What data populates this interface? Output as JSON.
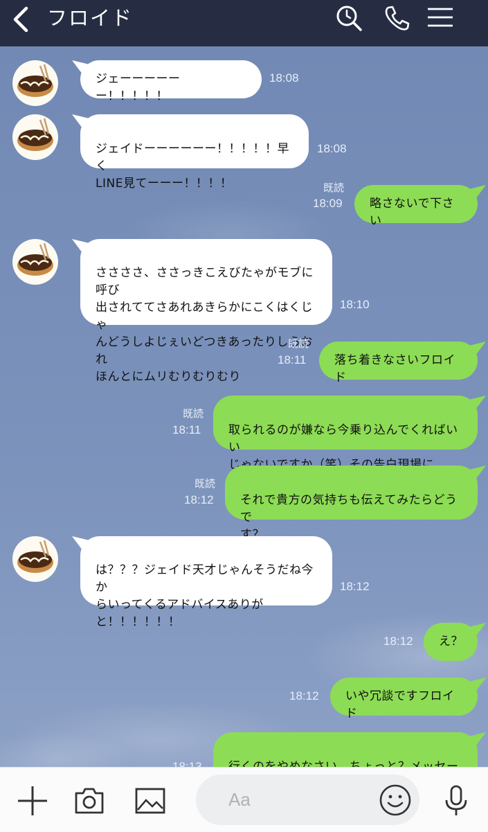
{
  "header": {
    "title": "フロイド"
  },
  "colors": {
    "header_bg": "#262d43",
    "chat_bg": "#7a90b8",
    "incoming_bubble": "#ffffff",
    "outgoing_bubble": "#8ddc55"
  },
  "messages": [
    {
      "side": "in",
      "text": "ジェーーーーーー！！！！！",
      "time": "18:08"
    },
    {
      "side": "in",
      "text": "ジェイドーーーーーー！！！！！早く\nLINE見てーーー！！！！",
      "time": "18:08"
    },
    {
      "side": "out",
      "text": "略さないで下さい",
      "time": "18:09",
      "read": "既読"
    },
    {
      "side": "in",
      "text": "ささささ、ささっきこえびたゃがモブに呼び\n出されててさあれあきらかにこくはくじゃ\nんどうしよじぇいどつきあったりしらおれ\nほんとにムリむりむりむり",
      "time": "18:10"
    },
    {
      "side": "out",
      "text": "落ち着きなさいフロイド",
      "time": "18:11",
      "read": "既読"
    },
    {
      "side": "out",
      "text": "取られるのが嫌なら今乗り込んでくればいい\nじゃないですか（笑）その告白現場に（笑）",
      "time": "18:11",
      "read": "既読"
    },
    {
      "side": "out",
      "text": "それで貴方の気持ちも伝えてみたらどうで\nす？",
      "time": "18:12",
      "read": "既読"
    },
    {
      "side": "in",
      "text": "は？？？ジェイド天才じゃんそうだね今か\nらいってくるアドバイスありが\nと！！！！！！",
      "time": "18:12"
    },
    {
      "side": "out",
      "text": "え？",
      "time": "18:12"
    },
    {
      "side": "out",
      "text": "いや冗談ですフロイド",
      "time": "18:12"
    },
    {
      "side": "out",
      "text": "行くのをやめなさい、ちょっと？メッセージ\n見て下さいよ",
      "time": "18:13"
    }
  ],
  "input": {
    "placeholder": "Aa"
  },
  "icons": {
    "back": "chevron-left-icon",
    "search": "search-clock-icon",
    "call": "phone-icon",
    "menu": "hamburger-menu-icon",
    "add": "plus-icon",
    "camera": "camera-icon",
    "image": "image-icon",
    "emoji": "emoji-icon",
    "voice": "microphone-icon"
  }
}
